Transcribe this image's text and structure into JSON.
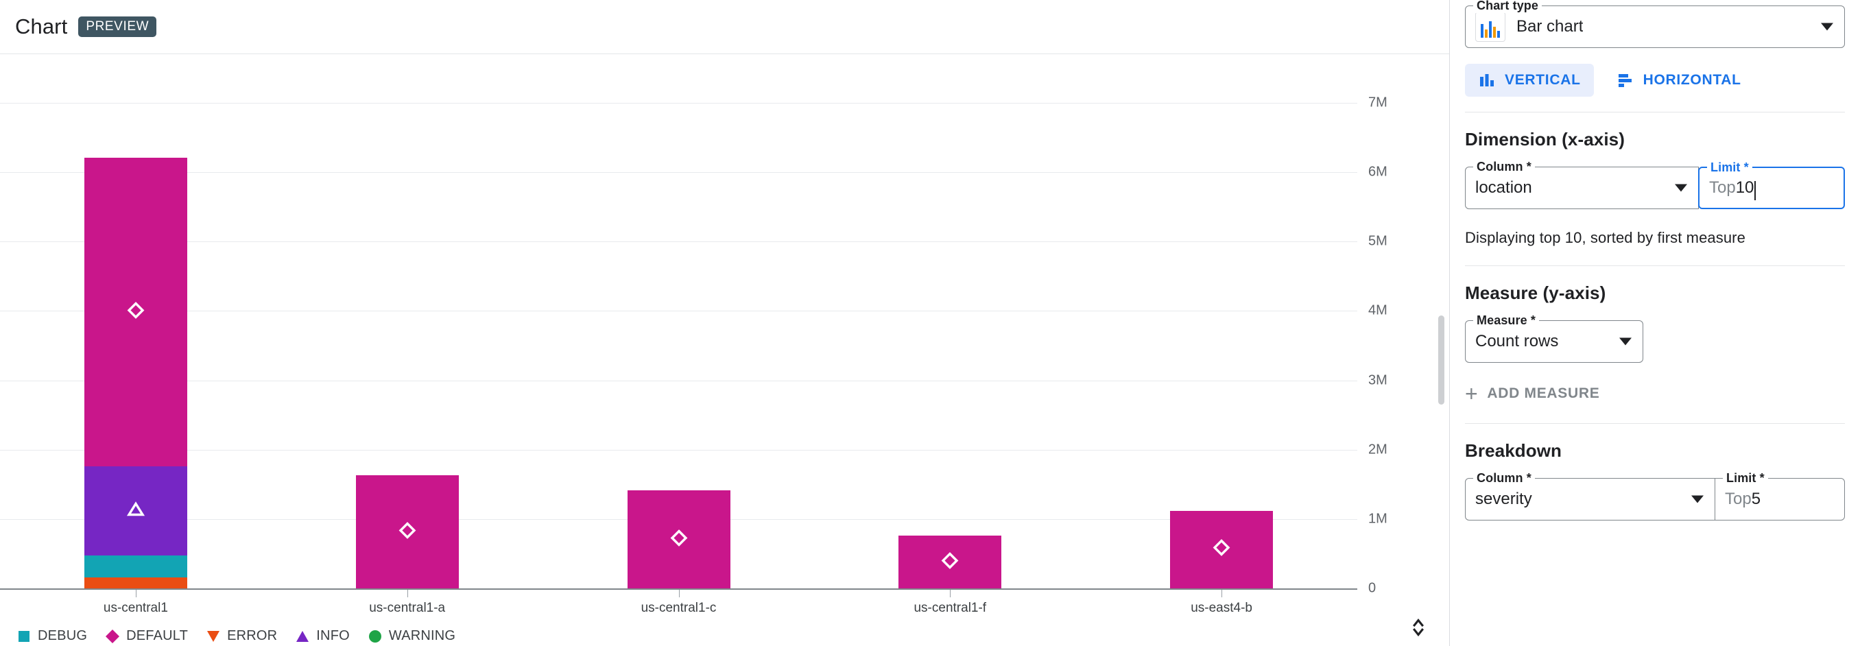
{
  "chart_panel": {
    "title": "Chart",
    "preview_badge": "PREVIEW"
  },
  "options": {
    "chart_type": {
      "label": "Chart type",
      "value": "Bar chart",
      "icon": "bar-chart-icon"
    },
    "orientation": {
      "vertical_label": "VERTICAL",
      "horizontal_label": "HORIZONTAL",
      "selected": "VERTICAL"
    },
    "dimension": {
      "section_title": "Dimension (x-axis)",
      "column_label": "Column *",
      "column_value": "location",
      "limit_label": "Limit *",
      "limit_prefix": "Top ",
      "limit_value": "10",
      "limit_focused": true,
      "helper_text": "Displaying top 10, sorted by first measure"
    },
    "measure": {
      "section_title": "Measure (y-axis)",
      "measure_label": "Measure *",
      "measure_value": "Count rows",
      "add_measure_label": "ADD MEASURE"
    },
    "breakdown": {
      "section_title": "Breakdown",
      "column_label": "Column *",
      "column_value": "severity",
      "limit_label": "Limit *",
      "limit_prefix": "Top ",
      "limit_value": "5"
    }
  },
  "colors": {
    "accent_blue": "#1a73e8",
    "debug": "#12a4b4",
    "default": "#c9168b",
    "error": "#ea4d13",
    "info": "#7626c4",
    "warning": "#1ea446",
    "badge_bg": "#3f5662",
    "gridline": "#e8eaed",
    "axis": "#80868b"
  },
  "chart_data": {
    "type": "bar",
    "subtype": "stacked-vertical",
    "title": "Chart",
    "xlabel": "location",
    "ylabel": "Count rows",
    "ylim": [
      0,
      7000000
    ],
    "yticks": [
      "0",
      "1M",
      "2M",
      "3M",
      "4M",
      "5M",
      "6M",
      "7M"
    ],
    "ytick_values": [
      0,
      1000000,
      2000000,
      3000000,
      4000000,
      5000000,
      6000000,
      7000000
    ],
    "grid": true,
    "legend_position": "bottom-left",
    "categories": [
      "us-central1",
      "us-central1-a",
      "us-central1-c",
      "us-central1-f",
      "us-east4-b"
    ],
    "series": [
      {
        "name": "DEBUG",
        "marker": "square",
        "color": "#12a4b4",
        "values": [
          310000,
          0,
          0,
          0,
          0
        ]
      },
      {
        "name": "DEFAULT",
        "marker": "diamond",
        "color": "#c9168b",
        "values": [
          4450000,
          1630000,
          1410000,
          760000,
          1120000
        ]
      },
      {
        "name": "ERROR",
        "marker": "triangle-down",
        "color": "#ea4d13",
        "values": [
          160000,
          0,
          0,
          0,
          0
        ]
      },
      {
        "name": "INFO",
        "marker": "triangle-up",
        "color": "#7626c4",
        "values": [
          1290000,
          0,
          0,
          0,
          0
        ]
      },
      {
        "name": "WARNING",
        "marker": "circle",
        "color": "#1ea446",
        "values": [
          0,
          0,
          0,
          0,
          0
        ]
      }
    ],
    "stack_order": [
      "ERROR",
      "DEBUG",
      "INFO",
      "DEFAULT"
    ],
    "totals": [
      6210000,
      1630000,
      1410000,
      760000,
      1120000
    ]
  }
}
